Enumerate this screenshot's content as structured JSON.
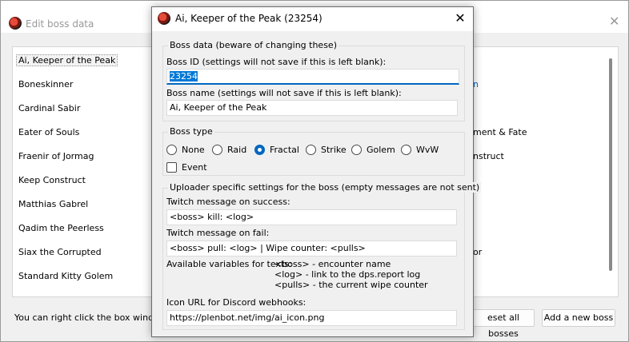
{
  "background_window": {
    "title": "Edit boss data",
    "list_left": [
      "Ai, Keeper of the Peak",
      "Boneskinner",
      "Cardinal Sabir",
      "Eater of Souls",
      "Fraenir of Jormag",
      "Keep Construct",
      "Matthias Gabrel",
      "Qadim the Peerless",
      "Siax the Corrupted",
      "Standard Kitty Golem"
    ],
    "list_right_fragments": [
      "n",
      "ment & Fate",
      "nstruct",
      "or"
    ],
    "hint": "You can right click the box window to",
    "reset_button": "eset all bosses",
    "add_button": "Add a new boss"
  },
  "dialog": {
    "title": "Ai, Keeper of the Peak (23254)",
    "close_glyph": "✕",
    "boss_data": {
      "legend": "Boss data (beware of changing these)",
      "id_label": "Boss ID (settings will not save if this is left blank):",
      "id_value": "23254",
      "name_label": "Boss name (settings will not save if this is left blank):",
      "name_value": "Ai, Keeper of the Peak"
    },
    "boss_type": {
      "legend": "Boss type",
      "options": [
        "None",
        "Raid",
        "Fractal",
        "Strike",
        "Golem",
        "WvW"
      ],
      "selected": "Fractal",
      "event_label": "Event",
      "event_checked": false
    },
    "uploader": {
      "legend": "Uploader specific settings for the boss (empty messages are not sent)",
      "success_label": "Twitch message on success:",
      "success_value": "<boss> kill: <log>",
      "fail_label": "Twitch message on fail:",
      "fail_value": "<boss> pull: <log> |  Wipe counter: <pulls>",
      "vars_label": "Available variables for texts:",
      "vars": [
        "<boss> - encounter name",
        "<log> - link to the dps.report log",
        "<pulls> - the current wipe counter"
      ],
      "icon_label": "Icon URL for Discord webhooks:",
      "icon_value": "https://plenbot.net/img/ai_icon.png"
    }
  }
}
